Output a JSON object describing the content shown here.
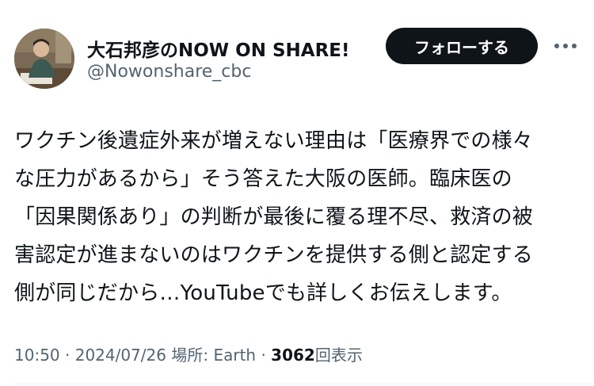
{
  "author": {
    "display_name": "大石邦彦のNOW ON SHARE!",
    "handle": "@Nowonshare_cbc"
  },
  "follow_button_label": "フォローする",
  "more_icon": "more-horizontal-icon",
  "tweet": {
    "lines": [
      "ワクチン後遺症外来が増えない理由は「医療界での様々",
      "な圧力があるから」そう答えた大阪の医師。臨床医の",
      "「因果関係あり」の判断が最後に覆る理不尽、救済の被",
      "害認定が進まないのはワクチンを提供する側と認定する",
      "側が同じだから…YouTubeでも詳しくお伝えします。"
    ]
  },
  "meta": {
    "time": "10:50",
    "separator": "·",
    "date": "2024/07/26",
    "location_label": "場所: Earth",
    "views_count": "3062",
    "views_label": "回表示"
  },
  "colors": {
    "text": "#0f1419",
    "secondary": "#536471",
    "button_bg": "#0f1419",
    "button_text": "#ffffff"
  }
}
